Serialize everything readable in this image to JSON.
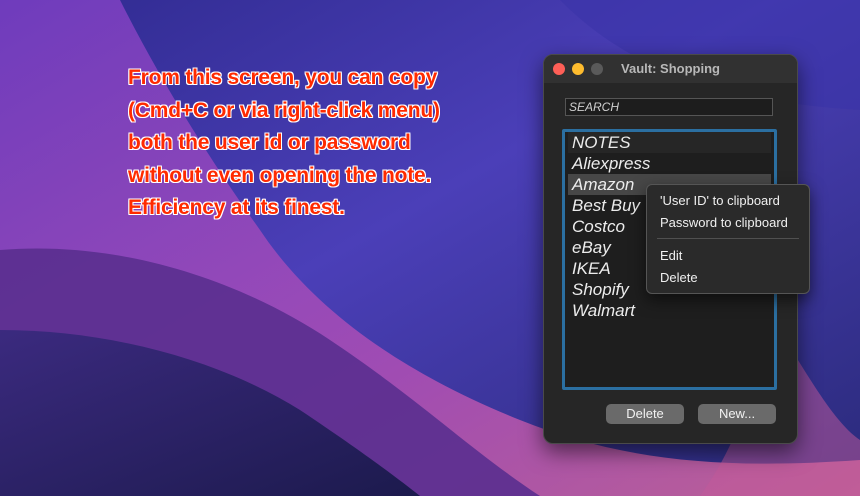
{
  "annotation": {
    "text": "From this screen, you can copy (Cmd+C or via right-click menu) both the user id or password without even opening the note. Efficiency at its finest."
  },
  "window": {
    "title": "Vault: Shopping",
    "search_placeholder": "SEARCH",
    "list": {
      "header": "NOTES",
      "items": [
        "Aliexpress",
        "Amazon",
        "Best Buy",
        "Costco",
        "eBay",
        "IKEA",
        "Shopify",
        "Walmart"
      ],
      "selected": "Amazon"
    },
    "buttons": {
      "delete_label": "Delete",
      "new_label": "New..."
    }
  },
  "context_menu": {
    "items": [
      "'User ID' to clipboard",
      "Password to clipboard",
      "Edit",
      "Delete"
    ]
  },
  "colors": {
    "annotation_text": "#ff2a00",
    "list_border": "#2b6fa1",
    "traffic_close": "#fe5f57",
    "traffic_minimize": "#febc2e"
  }
}
